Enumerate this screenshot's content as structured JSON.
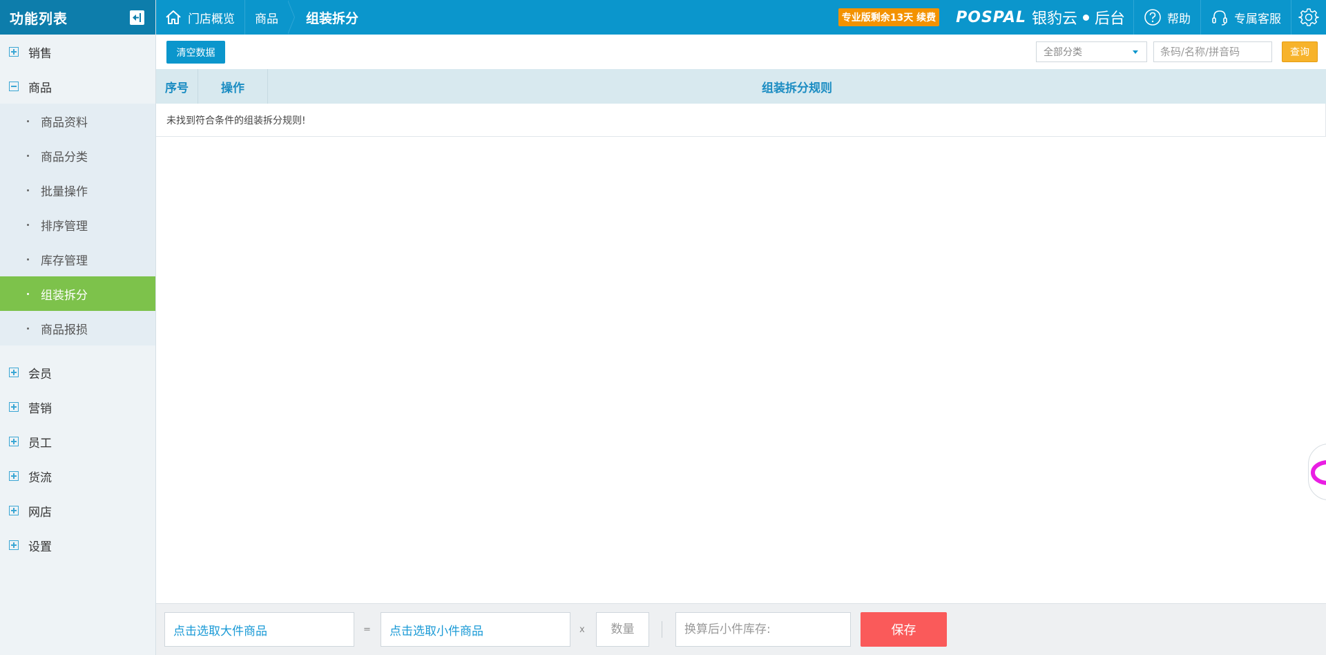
{
  "sidebar": {
    "title": "功能列表",
    "groups": [
      {
        "label": "销售",
        "expanded": false
      },
      {
        "label": "商品",
        "expanded": true,
        "items": [
          {
            "label": "商品资料"
          },
          {
            "label": "商品分类"
          },
          {
            "label": "批量操作"
          },
          {
            "label": "排序管理"
          },
          {
            "label": "库存管理"
          },
          {
            "label": "组装拆分",
            "active": true
          },
          {
            "label": "商品报损"
          }
        ]
      },
      {
        "label": "会员",
        "expanded": false
      },
      {
        "label": "营销",
        "expanded": false
      },
      {
        "label": "员工",
        "expanded": false
      },
      {
        "label": "货流",
        "expanded": false
      },
      {
        "label": "网店",
        "expanded": false
      },
      {
        "label": "设置",
        "expanded": false
      }
    ]
  },
  "topbar": {
    "breadcrumb": {
      "home": "门店概览",
      "section": "商品",
      "current": "组装拆分"
    },
    "badge": "专业版剩余13天 续费",
    "logo": {
      "brand": "POSPAL",
      "name": "银豹云",
      "suffix": "后台"
    },
    "help": "帮助",
    "support": "专属客服"
  },
  "toolbar": {
    "clear_label": "清空数据",
    "category_selected": "全部分类",
    "search_placeholder": "条码/名称/拼音码",
    "query_label": "查询"
  },
  "table": {
    "columns": [
      "序号",
      "操作",
      "组装拆分规则"
    ],
    "empty_message": "未找到符合条件的组装拆分规则!"
  },
  "bottombar": {
    "pick_big": "点击选取大件商品",
    "equals": "=",
    "pick_small": "点击选取小件商品",
    "times": "x",
    "qty_placeholder": "数量",
    "stock_placeholder": "换算后小件库存:",
    "save_label": "保存"
  },
  "colors": {
    "topbar": "#0b96cc",
    "sidebar_header": "#0d7dab",
    "active_item": "#7dc24b",
    "badge": "#f39200",
    "query_button": "#f7b32b",
    "save_button": "#fa5a5a"
  }
}
